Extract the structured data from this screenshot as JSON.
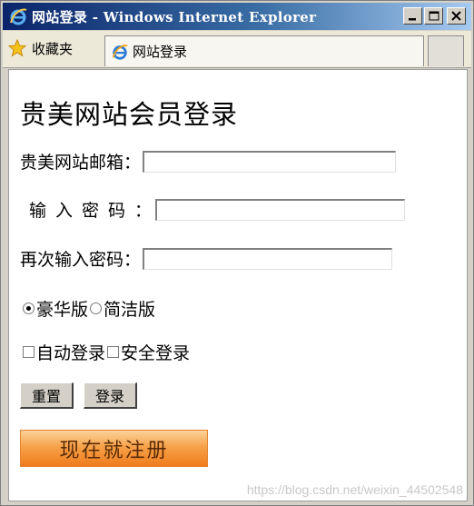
{
  "window": {
    "title": "网站登录 - Windows Internet Explorer",
    "title_icon": "ie-icon",
    "controls": [
      "minimize-icon",
      "maximize-icon",
      "close-icon"
    ]
  },
  "toolbar": {
    "favorites_label": "收藏夹",
    "favorites_icon": "star-icon",
    "tab_label": "网站登录",
    "tab_icon": "ie-icon"
  },
  "form": {
    "title": "贵美网站会员登录",
    "email_label": "贵美网站邮箱：",
    "email_value": "",
    "password_label": "输入密码：",
    "password_value": "",
    "confirm_label": "再次输入密码：",
    "confirm_value": "",
    "radios": [
      {
        "label": "豪华版",
        "checked": true
      },
      {
        "label": "简洁版",
        "checked": false
      }
    ],
    "checkboxes": [
      {
        "label": "自动登录",
        "checked": false
      },
      {
        "label": "安全登录",
        "checked": false
      }
    ],
    "reset_label": "重置",
    "login_label": "登录",
    "register_label": "现在就注册"
  },
  "watermark": "https://blog.csdn.net/weixin_44502548",
  "colors": {
    "titlebar_start": "#0a246a",
    "titlebar_end": "#a6caf0",
    "register_orange": "#f7a24a",
    "chrome": "#d4d0c8"
  }
}
